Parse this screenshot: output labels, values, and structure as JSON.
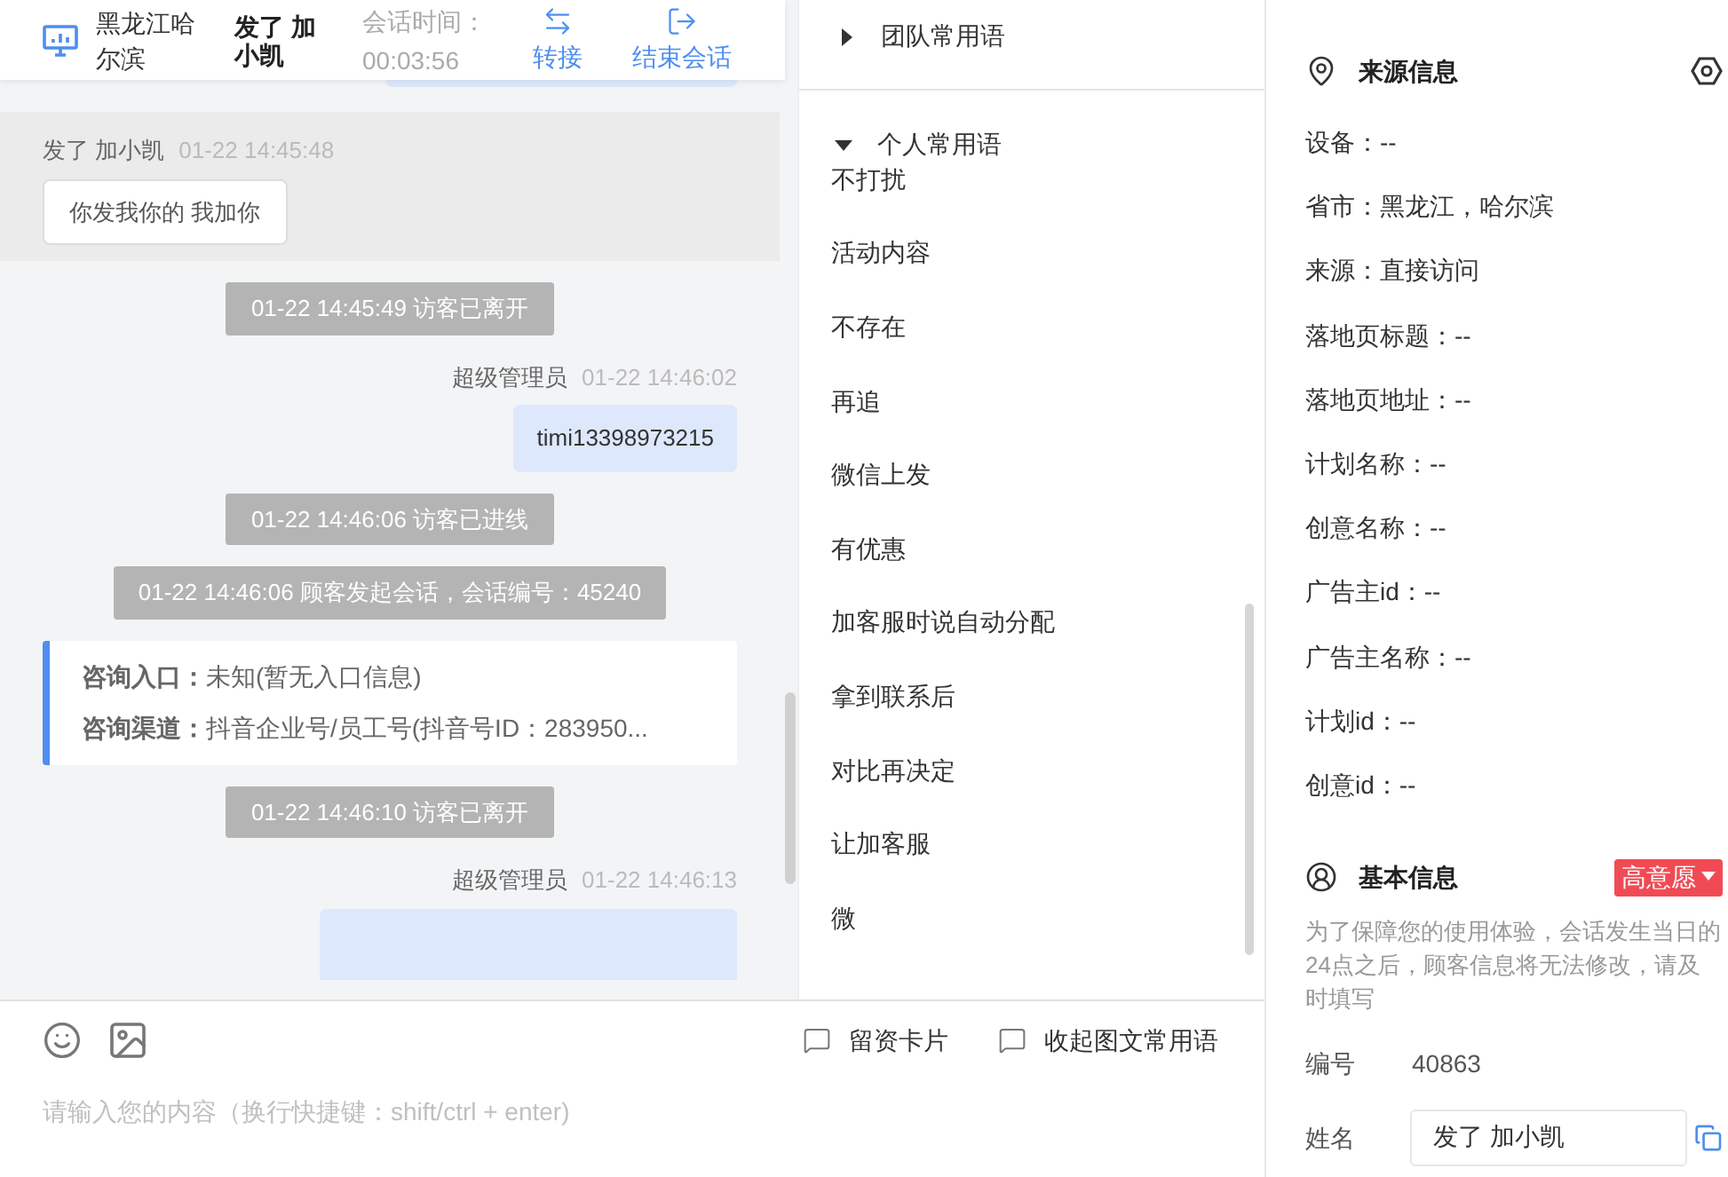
{
  "header": {
    "location": "黑龙江哈尔滨",
    "visitor_name": "发了 加小凯",
    "session_time_label": "会话时间：",
    "session_time": "00:03:56",
    "actions": [
      {
        "label": "转接",
        "kind": "transfer"
      },
      {
        "label": "结束会话",
        "kind": "end"
      }
    ]
  },
  "messages": [
    {
      "kind": "visitor",
      "sender": "发了 加小凯",
      "time": "01-22 14:45:48",
      "text": "你发我你的 我加你"
    },
    {
      "kind": "system",
      "text": "01-22 14:45:49 访客已离开"
    },
    {
      "kind": "agent",
      "sender": "超级管理员",
      "time": "01-22 14:46:02",
      "text": "timi13398973215"
    },
    {
      "kind": "system",
      "text": "01-22 14:46:06 访客已进线"
    },
    {
      "kind": "system",
      "text": "01-22 14:46:06 顾客发起会话，会话编号：45240"
    },
    {
      "kind": "info_card",
      "rows": [
        "**咨询入口：**未知(暂无入口信息)",
        "**咨询渠道：**抖音企业号/员工号(抖音号ID：283950..."
      ]
    },
    {
      "kind": "system",
      "text": "01-22 14:46:10 访客已离开"
    },
    {
      "kind": "agent_cut",
      "sender": "超级管理员",
      "time": "01-22 14:46:13"
    }
  ],
  "phrase_groups": [
    {
      "title": "团队常用语",
      "expanded": false
    },
    {
      "title": "个人常用语",
      "expanded": true,
      "items": [
        "不打扰",
        "活动内容",
        "不存在",
        "再追",
        "微信上发",
        "有优惠",
        "加客服时说自动分配",
        "拿到联系后",
        "对比再决定",
        "让加客服",
        "微"
      ]
    }
  ],
  "composer": {
    "tools": [
      {
        "label": "留资卡片"
      },
      {
        "label": "收起图文常用语"
      }
    ],
    "placeholder": "请输入您的内容（换行快捷键：shift/ctrl + enter)"
  },
  "source_info": {
    "title": "来源信息",
    "rows": [
      "设备：--",
      "省市：黑龙江，哈尔滨",
      "来源：直接访问",
      "落地页标题：--",
      "落地页地址：--",
      "计划名称：--",
      "创意名称：--",
      "广告主id：--",
      "广告主名称：--",
      "计划id：--",
      "创意id：--"
    ]
  },
  "basic_info": {
    "title": "基本信息",
    "tag": "高意愿",
    "note": "为了保障您的使用体验，会话发生当日的24点之后，顾客信息将无法修改，请及时填写",
    "fields": [
      {
        "kind": "text",
        "label": "编号",
        "value": "40863"
      },
      {
        "kind": "input",
        "label": "姓名",
        "value": "发了 加小凯"
      }
    ]
  }
}
